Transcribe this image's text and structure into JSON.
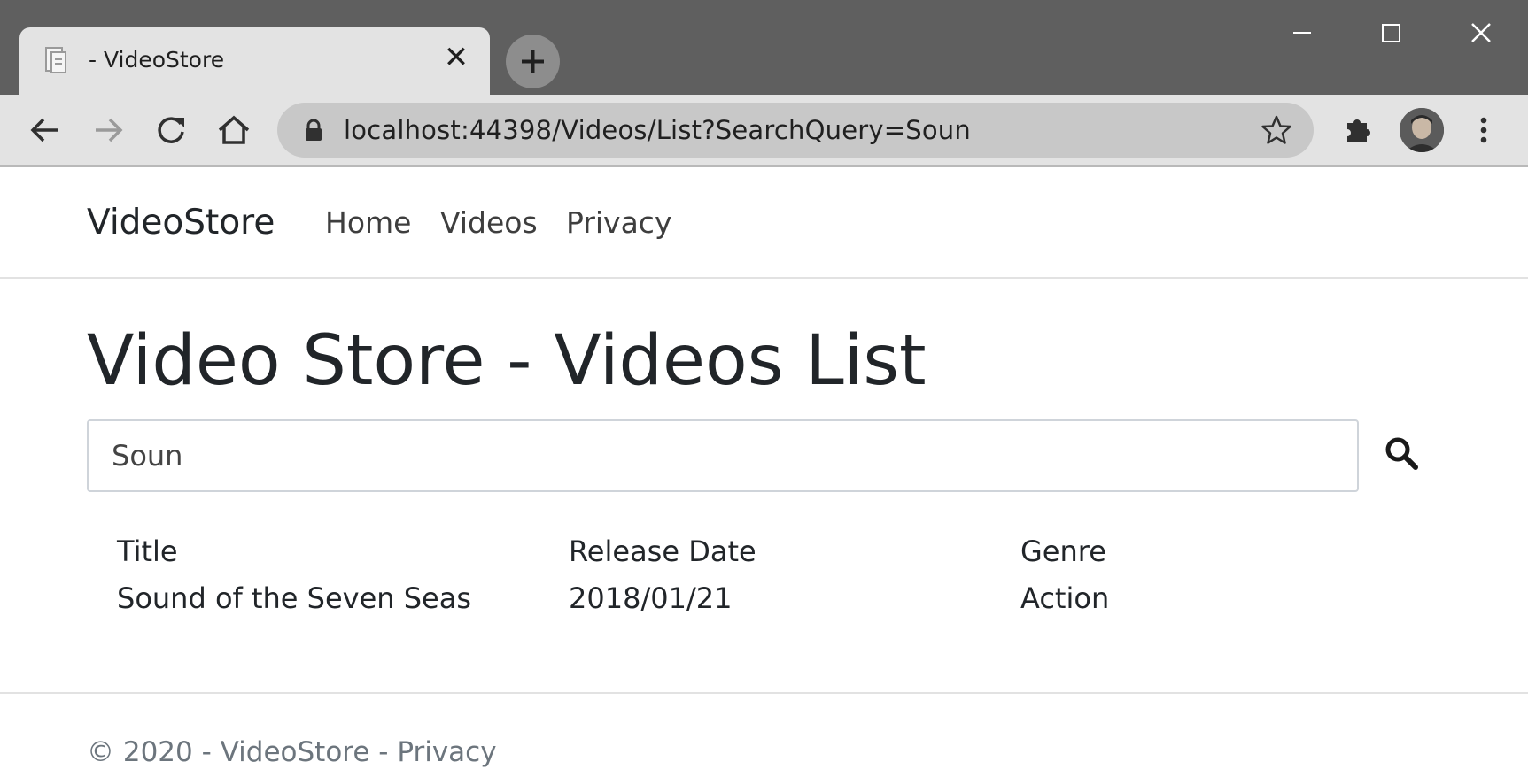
{
  "browser": {
    "tab_title": "- VideoStore",
    "url": "localhost:44398/Videos/List?SearchQuery=Soun"
  },
  "navbar": {
    "brand": "VideoStore",
    "links": [
      "Home",
      "Videos",
      "Privacy"
    ]
  },
  "main": {
    "title": "Video Store - Videos List",
    "search": {
      "value": "Soun"
    },
    "table": {
      "headers": [
        "Title",
        "Release Date",
        "Genre"
      ],
      "rows": [
        [
          "Sound of the Seven Seas",
          "2018/01/21",
          "Action"
        ]
      ]
    }
  },
  "footer": {
    "prefix": "© 2020 - VideoStore - ",
    "link": "Privacy"
  },
  "colors": {
    "tabstrip": "#5f5f5f",
    "toolbar": "#e3e3e3",
    "omnibox": "#c8c8c8",
    "text": "#212529",
    "muted": "#6c757d"
  }
}
